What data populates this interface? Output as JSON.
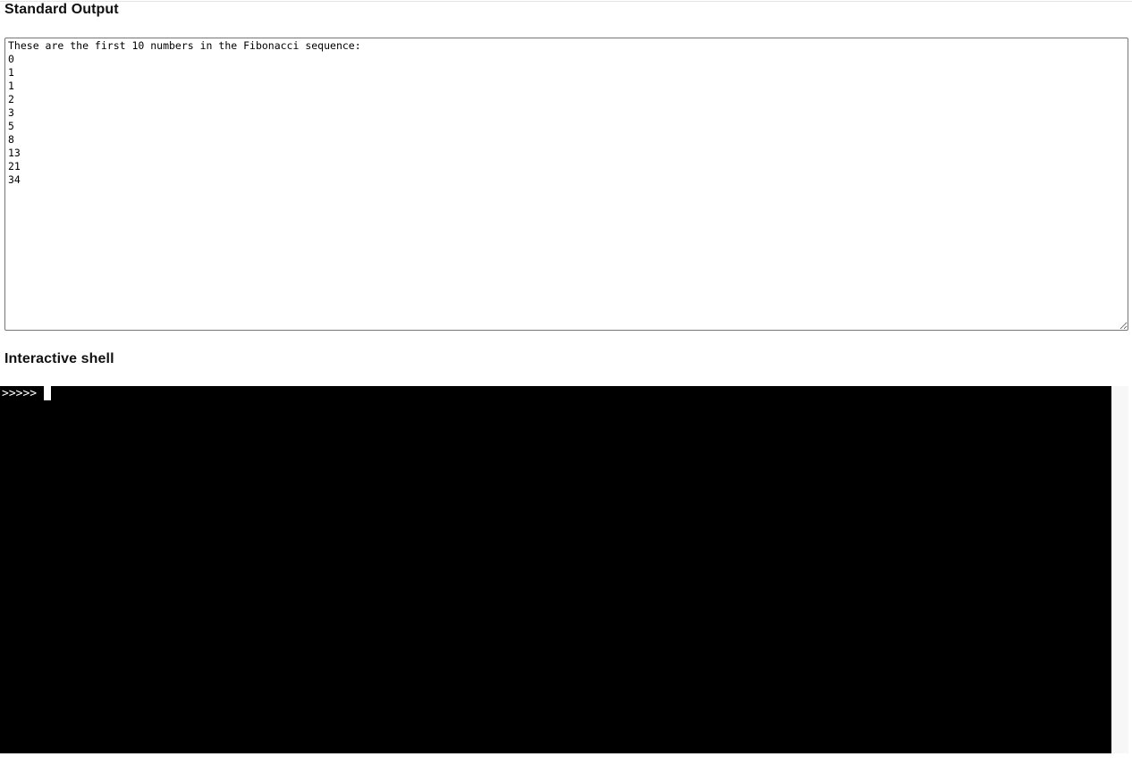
{
  "page": {
    "background_color": "#ffffff",
    "divider_color": "#e3e3e3"
  },
  "stdout_section": {
    "heading": "Standard Output",
    "output_text": "These are the first 10 numbers in the Fibonacci sequence:\n0\n1\n1\n2\n3\n5\n8\n13\n21\n34\n",
    "placeholder": "",
    "border_color": "#767676",
    "text_color": "#000000",
    "background_color": "#ffffff",
    "resize_handle": "resize-grip-icon"
  },
  "shell_section": {
    "heading": "Interactive shell",
    "prompt": ">>>>>",
    "input_value": "",
    "cursor": "block-cursor",
    "background_color": "#000000",
    "text_color": "#ffffff",
    "container_color": "#f7f7f7"
  }
}
